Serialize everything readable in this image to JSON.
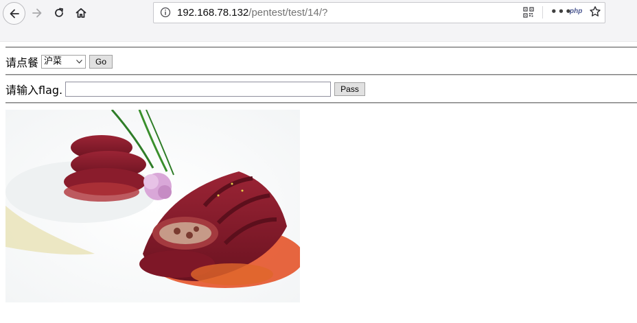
{
  "browser": {
    "url_host": "192.168.78.132",
    "url_path": "/pentest/test/14/?",
    "extension_label": "php"
  },
  "order_form": {
    "label": "请点餐",
    "selected_option": "沪菜",
    "go_label": "Go"
  },
  "flag_form": {
    "label": "请输入flag.",
    "value": "",
    "pass_label": "Pass"
  },
  "image": {
    "icon": "food-dish-image"
  }
}
